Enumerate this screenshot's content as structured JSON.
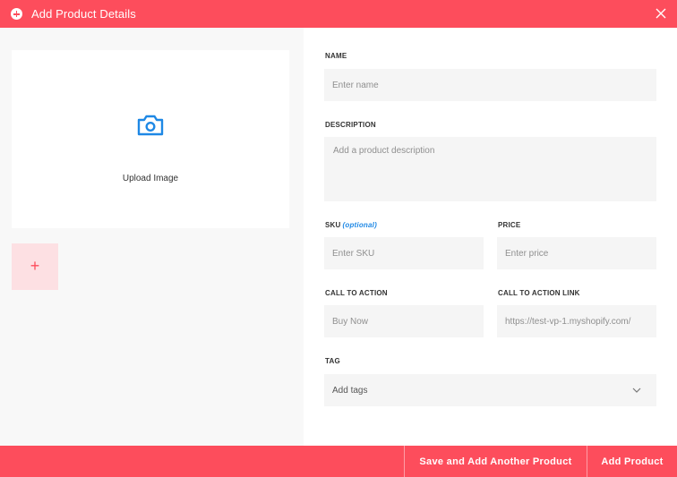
{
  "header": {
    "title": "Add Product Details",
    "icon": "plus-circle-icon",
    "close_icon": "close-icon"
  },
  "upload": {
    "label": "Upload Image",
    "icon": "camera-icon",
    "add_icon_glyph": "+"
  },
  "form": {
    "name": {
      "label": "NAME",
      "placeholder": "Enter name"
    },
    "description": {
      "label": "DESCRIPTION",
      "placeholder": "Add a product description"
    },
    "sku": {
      "label": "SKU",
      "optional": "(optional)",
      "placeholder": "Enter SKU"
    },
    "price": {
      "label": "PRICE",
      "placeholder": "Enter price"
    },
    "cta": {
      "label": "CALL TO ACTION",
      "placeholder": "Buy Now"
    },
    "cta_link": {
      "label": "CALL TO ACTION LINK",
      "placeholder": "https://test-vp-1.myshopify.com/"
    },
    "tag": {
      "label": "TAG",
      "value": "Add tags"
    }
  },
  "footer": {
    "save_another_label": "Save and Add Another Product",
    "add_label": "Add Product"
  },
  "colors": {
    "accent": "#fd4d5c",
    "accent_light": "#fde0e3",
    "link_blue": "#1e88e5"
  }
}
